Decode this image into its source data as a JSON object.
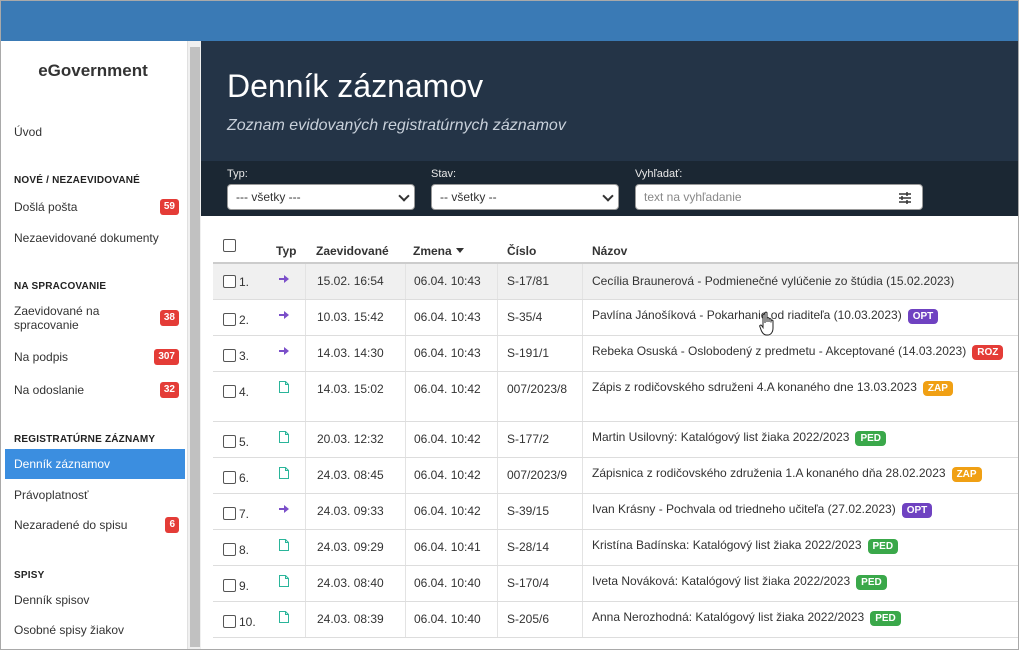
{
  "sidebar": {
    "brand": "eGovernment",
    "home": "Úvod",
    "sections": [
      {
        "title": "NOVÉ / NEZAEVIDOVANÉ"
      },
      {
        "title": "NA SPRACOVANIE"
      },
      {
        "title": "REGISTRATÚRNE ZÁZNAMY"
      },
      {
        "title": "SPISY"
      }
    ],
    "items": [
      {
        "label": "Došlá pošta",
        "badge": "59"
      },
      {
        "label": "Nezaevidované dokumenty",
        "badge": ""
      },
      {
        "label": "Zaevidované na spracovanie",
        "badge": "38"
      },
      {
        "label": "Na podpis",
        "badge": "307"
      },
      {
        "label": "Na odoslanie",
        "badge": "32"
      },
      {
        "label": "Denník záznamov",
        "badge": ""
      },
      {
        "label": "Právoplatnosť",
        "badge": ""
      },
      {
        "label": "Nezaradené do spisu",
        "badge": "6"
      },
      {
        "label": "Denník spisov",
        "badge": ""
      },
      {
        "label": "Osobné spisy žiakov",
        "badge": ""
      }
    ]
  },
  "header": {
    "title": "Denník záznamov",
    "subtitle": "Zoznam evidovaných registratúrnych záznamov"
  },
  "filters": {
    "type_label": "Typ:",
    "type_value": "--- všetky ---",
    "state_label": "Stav:",
    "state_value": "-- všetky --",
    "search_label": "Vyhľadať:",
    "search_placeholder": "text na vyhľadanie"
  },
  "table": {
    "headers": {
      "type": "Typ",
      "registered": "Zaevidované",
      "changed": "Zmena",
      "number": "Číslo",
      "name": "Názov"
    },
    "rows": [
      {
        "n": "1.",
        "icon": "incoming-arrow-icon",
        "registered": "15.02. 16:54",
        "changed": "06.04. 10:43",
        "number": "S-17/81",
        "name": "Cecília Braunerová - Podmienečné vylúčenie zo štúdia (15.02.2023)",
        "tag": ""
      },
      {
        "n": "2.",
        "icon": "incoming-arrow-icon",
        "registered": "10.03. 15:42",
        "changed": "06.04. 10:43",
        "number": "S-35/4",
        "name": "Pavlína Jánošíková - Pokarhanie od riaditeľa (10.03.2023)",
        "tag": "OPT"
      },
      {
        "n": "3.",
        "icon": "incoming-arrow-icon",
        "registered": "14.03. 14:30",
        "changed": "06.04. 10:43",
        "number": "S-191/1",
        "name": "Rebeka Osuská - Oslobodený z predmetu - Akceptované (14.03.2023)",
        "tag": "ROZ"
      },
      {
        "n": "4.",
        "icon": "document-icon",
        "registered": "14.03. 15:02",
        "changed": "06.04. 10:42",
        "number": "007/2023/8",
        "name": "Zápis z rodičovského sdruženi 4.A konaného dne 13.03.2023",
        "tag": "ZAP"
      },
      {
        "n": "5.",
        "icon": "document-icon",
        "registered": "20.03. 12:32",
        "changed": "06.04. 10:42",
        "number": "S-177/2",
        "name": "Martin Usilovný: Katalógový list žiaka 2022/2023",
        "tag": "PED"
      },
      {
        "n": "6.",
        "icon": "document-icon",
        "registered": "24.03. 08:45",
        "changed": "06.04. 10:42",
        "number": "007/2023/9",
        "name": "Zápisnica z rodičovského združenia 1.A konaného dňa 28.02.2023",
        "tag": "ZAP"
      },
      {
        "n": "7.",
        "icon": "incoming-arrow-icon",
        "registered": "24.03. 09:33",
        "changed": "06.04. 10:42",
        "number": "S-39/15",
        "name": "Ivan Krásny - Pochvala od triedneho učiteľa (27.02.2023)",
        "tag": "OPT"
      },
      {
        "n": "8.",
        "icon": "document-icon",
        "registered": "24.03. 09:29",
        "changed": "06.04. 10:41",
        "number": "S-28/14",
        "name": "Kristína Badínska: Katalógový list žiaka 2022/2023",
        "tag": "PED"
      },
      {
        "n": "9.",
        "icon": "document-icon",
        "registered": "24.03. 08:40",
        "changed": "06.04. 10:40",
        "number": "S-170/4",
        "name": "Iveta Nováková: Katalógový list žiaka 2022/2023",
        "tag": "PED"
      },
      {
        "n": "10.",
        "icon": "document-icon",
        "registered": "24.03. 08:39",
        "changed": "06.04. 10:40",
        "number": "S-205/6",
        "name": "Anna Nerozhodná: Katalógový list žiaka 2022/2023",
        "tag": "PED"
      }
    ]
  },
  "colors": {
    "topbar": "#3a7ab5",
    "hero": "#243447",
    "active": "#3b8ee0",
    "icon": "#7b4fc9"
  }
}
